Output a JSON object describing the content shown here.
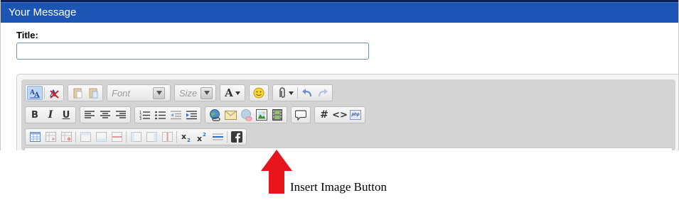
{
  "panel": {
    "header": "Your Message"
  },
  "form": {
    "title_label": "Title:",
    "title_value": ""
  },
  "toolbar": {
    "font_placeholder": "Font",
    "size_placeholder": "Size",
    "font_color_glyph": "A",
    "hash_glyph": "#",
    "code_glyph": "<>",
    "php_label": "php"
  },
  "annotation": {
    "text": "Insert Image Button",
    "arrow_color": "#e8141c"
  },
  "colors": {
    "header": "#1d55b5",
    "toolbar": "#d4d4d4"
  }
}
